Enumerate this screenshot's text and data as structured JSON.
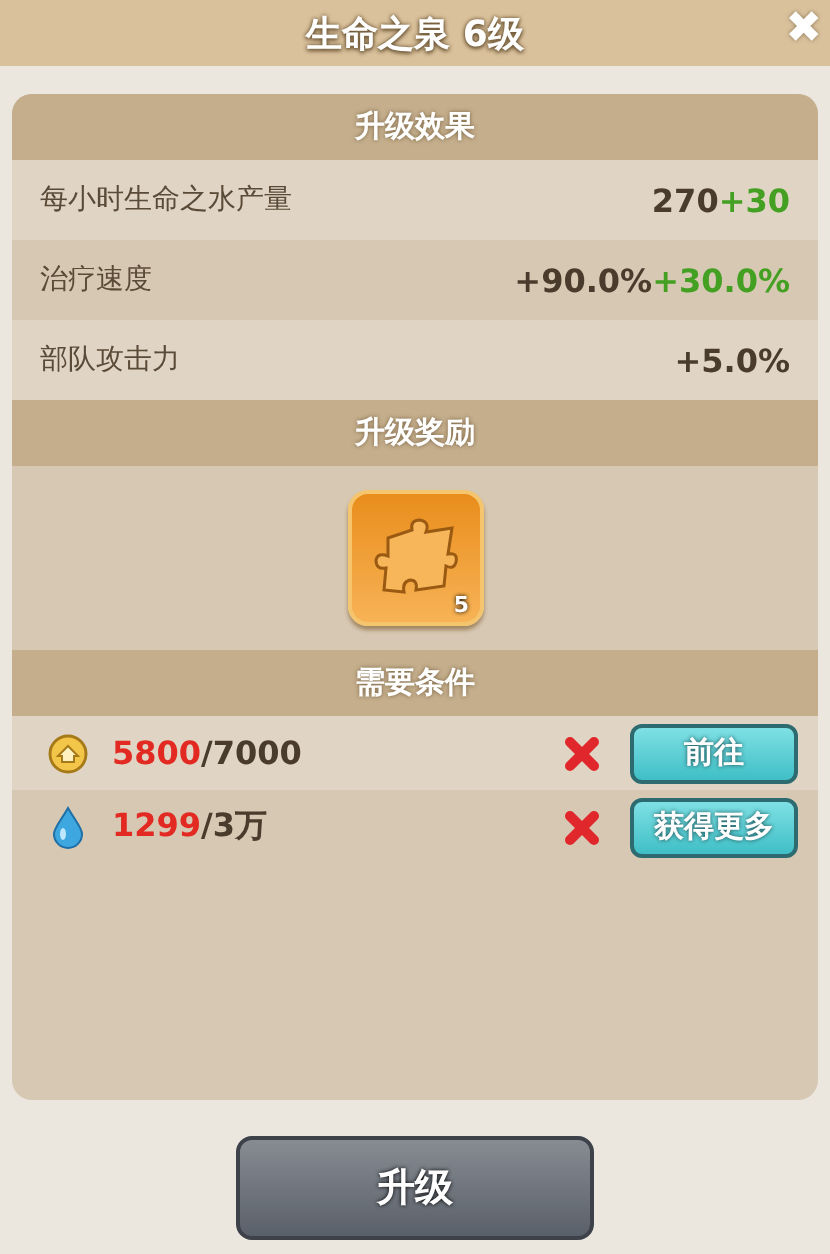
{
  "window": {
    "title": "生命之泉 6级",
    "close": "✖"
  },
  "effects": {
    "heading": "升级效果",
    "rows": [
      {
        "label": "每小时生命之水产量",
        "parts": [
          {
            "kind": "base",
            "text": "270"
          },
          {
            "kind": "bonus",
            "text": "+30"
          }
        ]
      },
      {
        "label": "治疗速度",
        "parts": [
          {
            "kind": "base",
            "text": "+90.0%"
          },
          {
            "kind": "bonus",
            "text": "+30.0%"
          }
        ]
      },
      {
        "label": "部队攻击力",
        "parts": [
          {
            "kind": "base",
            "text": "+5.0%"
          }
        ]
      }
    ]
  },
  "rewards": {
    "heading": "升级奖励",
    "items": [
      {
        "kind": "puzzle",
        "count": "5"
      }
    ]
  },
  "requirements": {
    "heading": "需要条件",
    "rows": [
      {
        "kind": "coin",
        "current": "5800",
        "required": "/7000",
        "met": false,
        "action": "前往"
      },
      {
        "kind": "water",
        "current": "1299",
        "required": "/3万",
        "met": false,
        "action": "获得更多"
      }
    ]
  },
  "upgrade_button": {
    "label": "升级",
    "disabled": true
  }
}
